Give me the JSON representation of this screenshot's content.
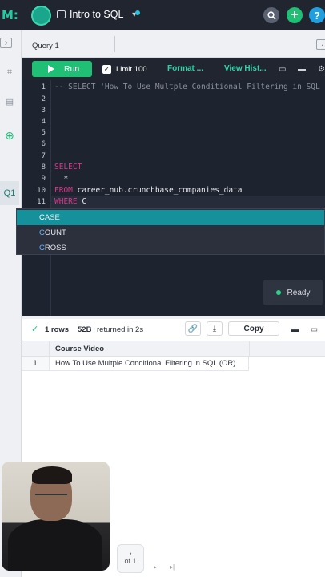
{
  "app": {
    "logo": "M:",
    "title": "Intro to SQL"
  },
  "header": {
    "search_icon": "search-icon",
    "add_icon": "plus-icon",
    "help_label": "?"
  },
  "tabs": {
    "query_tab": "Query 1"
  },
  "left_rail": {
    "q1_label": "Q1"
  },
  "toolbar": {
    "run_label": "Run",
    "limit_label": "Limit 100",
    "format_label": "Format ...",
    "history_label": "View Hist..."
  },
  "editor": {
    "line_numbers": [
      "1",
      "2",
      "3",
      "4",
      "5",
      "6",
      "7",
      "8",
      "9",
      "10",
      "11"
    ],
    "line1": "-- SELECT 'How To Use Multple Conditional Filtering in SQL",
    "line8": "SELECT",
    "line9": "  *",
    "line10_kw": "FROM",
    "line10_rest": " career_nub.crunchbase_companies_data",
    "line11_kw": "WHERE",
    "line11_rest": " C"
  },
  "autocomplete": {
    "items": [
      {
        "hl": "C",
        "rest": "ASE"
      },
      {
        "hl": "C",
        "rest": "OUNT"
      },
      {
        "hl": "C",
        "rest": "ROSS"
      }
    ]
  },
  "status": {
    "ready": "Ready"
  },
  "results": {
    "rows": "1 rows",
    "size": "52B",
    "returned": "returned in 2s",
    "copy_label": "Copy"
  },
  "grid": {
    "header": "Course Video",
    "row_num": "1",
    "cell": "How To Use Multple Conditional Filtering in SQL (OR)"
  },
  "pager": {
    "of": "of 1"
  },
  "colors": {
    "accent": "#1fbf75",
    "teal": "#14919a",
    "keyword": "#d63a8a"
  }
}
